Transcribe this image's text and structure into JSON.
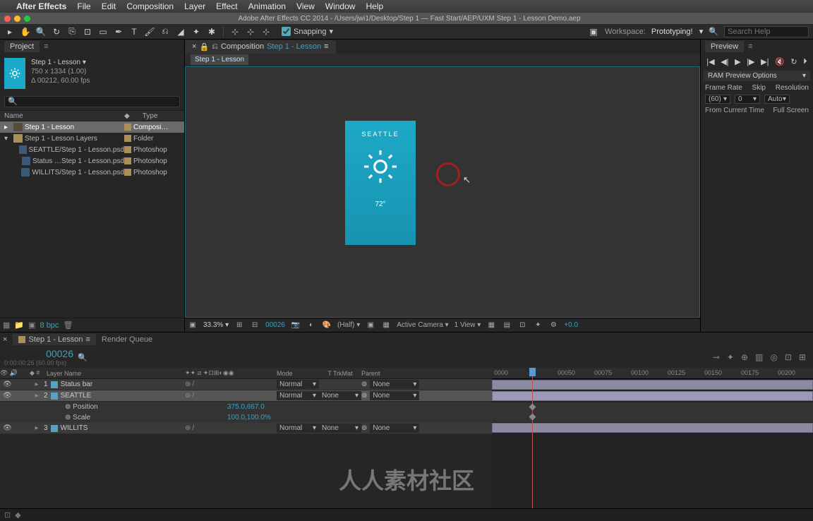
{
  "mac_menu": {
    "app_name": "After Effects",
    "items": [
      "File",
      "Edit",
      "Composition",
      "Layer",
      "Effect",
      "Animation",
      "View",
      "Window",
      "Help"
    ]
  },
  "window_title": "Adobe After Effects CC 2014 - /Users/jwi1/Desktop/Step 1 — Fast Start/AEP/UXM Step 1 - Lesson Demo.aep",
  "toolbar": {
    "snapping_label": "Snapping",
    "workspace_label": "Workspace:",
    "workspace_name": "Prototyping!",
    "search_placeholder": "Search Help"
  },
  "project": {
    "panel_label": "Project",
    "name": "Step 1 - Lesson ▾",
    "dims": "750 x 1334 (1.00)",
    "dur": "Δ 00212, 60.00 fps",
    "col_name": "Name",
    "col_type": "Type",
    "items": [
      {
        "indent": 0,
        "twirl": "▸",
        "icon": "comp",
        "name": "Step 1 - Lesson",
        "type": "Composi…",
        "swatch": "#a8905a",
        "sel": true
      },
      {
        "indent": 0,
        "twirl": "▾",
        "icon": "folder",
        "name": "Step 1 - Lesson Layers",
        "type": "Folder",
        "swatch": "#a8905a",
        "sel": false
      },
      {
        "indent": 1,
        "twirl": "",
        "icon": "psd",
        "name": "SEATTLE/Step 1 - Lesson.psd",
        "type": "Photoshop",
        "swatch": "#a8905a",
        "sel": false
      },
      {
        "indent": 1,
        "twirl": "",
        "icon": "psd",
        "name": "Status …Step 1 - Lesson.psd",
        "type": "Photoshop",
        "swatch": "#a8905a",
        "sel": false
      },
      {
        "indent": 1,
        "twirl": "",
        "icon": "psd",
        "name": "WILLITS/Step 1 - Lesson.psd",
        "type": "Photoshop",
        "swatch": "#a8905a",
        "sel": false
      }
    ],
    "bpc": "8 bpc"
  },
  "composition": {
    "tab_label": "Composition",
    "tab_name": "Step 1 - Lesson",
    "subtab": "Step 1 - Lesson",
    "phone_city": "SEATTLE",
    "phone_temp": "72°",
    "zoom": "33.3%",
    "timecode": "00026",
    "half": "(Half)",
    "camera": "Active Camera",
    "view": "1 View",
    "exposure": "+0.0"
  },
  "preview": {
    "panel_label": "Preview",
    "ram_label": "RAM Preview Options",
    "frame_rate_label": "Frame Rate",
    "skip_label": "Skip",
    "resolution_label": "Resolution",
    "frame_rate": "(60)",
    "skip": "0",
    "resolution": "Auto",
    "from_current": "From Current Time",
    "full_screen": "Full Screen"
  },
  "timeline": {
    "tab_name": "Step 1 - Lesson",
    "render_queue": "Render Queue",
    "big_time": "00026",
    "small_time": "0:00:00:26 (60.00 fps)",
    "col_layer": "Layer Name",
    "col_mode": "Mode",
    "col_trk": "T  TrkMat",
    "col_parent": "Parent",
    "layers": [
      {
        "num": "1",
        "name": "Status bar",
        "mode": "Normal",
        "trk": "",
        "parent": "None",
        "sel": false
      },
      {
        "num": "2",
        "name": "SEATTLE",
        "mode": "Normal",
        "trk": "None",
        "parent": "None",
        "sel": true
      },
      {
        "num": "3",
        "name": "WILLITS",
        "mode": "Normal",
        "trk": "None",
        "parent": "None",
        "sel": false
      }
    ],
    "props": [
      {
        "name": "Position",
        "value": "375.0,667.0"
      },
      {
        "name": "Scale",
        "value": "100.0,100.0%"
      }
    ],
    "ruler_ticks": [
      "0000",
      "00050",
      "00075",
      "00100",
      "00125",
      "00150",
      "00175",
      "00200"
    ]
  },
  "watermark": "人人素材社区"
}
